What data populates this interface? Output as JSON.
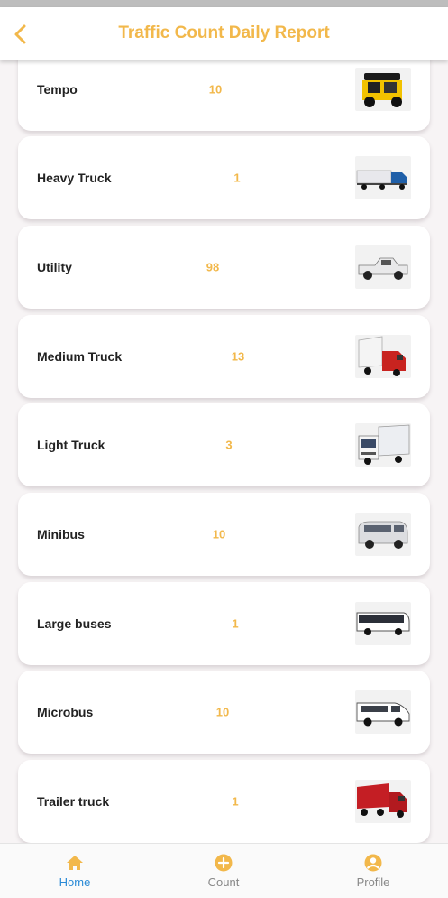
{
  "header": {
    "title": "Traffic Count Daily Report"
  },
  "vehicles": [
    {
      "name": "Tempo",
      "count": "10",
      "icon": "tempo-image"
    },
    {
      "name": "Heavy Truck",
      "count": "1",
      "icon": "heavy-truck-image"
    },
    {
      "name": "Utility",
      "count": "98",
      "icon": "utility-pickup-image"
    },
    {
      "name": "Medium Truck",
      "count": "13",
      "icon": "medium-truck-image"
    },
    {
      "name": "Light Truck",
      "count": "3",
      "icon": "light-truck-image"
    },
    {
      "name": "Minibus",
      "count": "10",
      "icon": "minibus-image"
    },
    {
      "name": "Large buses",
      "count": "1",
      "icon": "large-bus-image"
    },
    {
      "name": "Microbus",
      "count": "10",
      "icon": "microbus-image"
    },
    {
      "name": "Trailer truck",
      "count": "1",
      "icon": "trailer-truck-image"
    }
  ],
  "nav": {
    "home": {
      "label": "Home",
      "icon": "home-icon"
    },
    "count": {
      "label": "Count",
      "icon": "add-circle-icon"
    },
    "profile": {
      "label": "Profile",
      "icon": "profile-icon"
    }
  },
  "colors": {
    "accent": "#f2b84b",
    "active_nav": "#2a8ad6",
    "inactive_nav": "#888888",
    "background": "#f7f4f5"
  }
}
